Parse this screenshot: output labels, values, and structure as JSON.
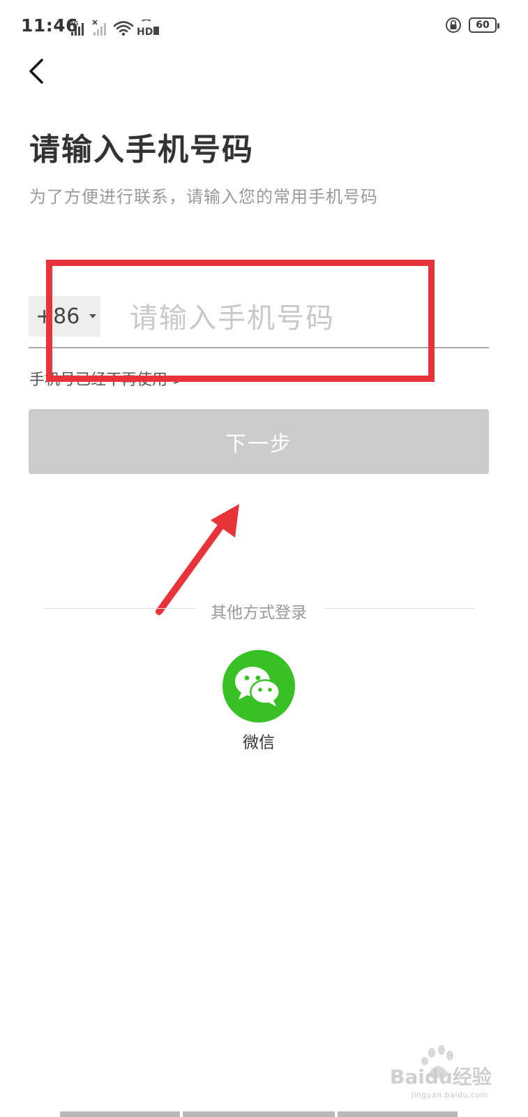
{
  "status_bar": {
    "time": "11:46",
    "network_label": "4G",
    "hd_label": "HD",
    "battery_level": "60"
  },
  "header": {
    "title": "请输入手机号码",
    "subtitle": "为了方便进行联系，请输入您的常用手机号码"
  },
  "form": {
    "country_code": "+86",
    "phone_placeholder": "请输入手机号码",
    "phone_value": "",
    "unused_phone_link": "手机号已经不再使用 >",
    "next_button_label": "下一步"
  },
  "other_login": {
    "label": "其他方式登录",
    "wechat_label": "微信",
    "wechat_color": "#38c124"
  },
  "annotations": {
    "highlight_color": "#e8333a"
  },
  "watermark": {
    "brand": "Baidu经验",
    "sub": "jingyan.baidu.com"
  }
}
